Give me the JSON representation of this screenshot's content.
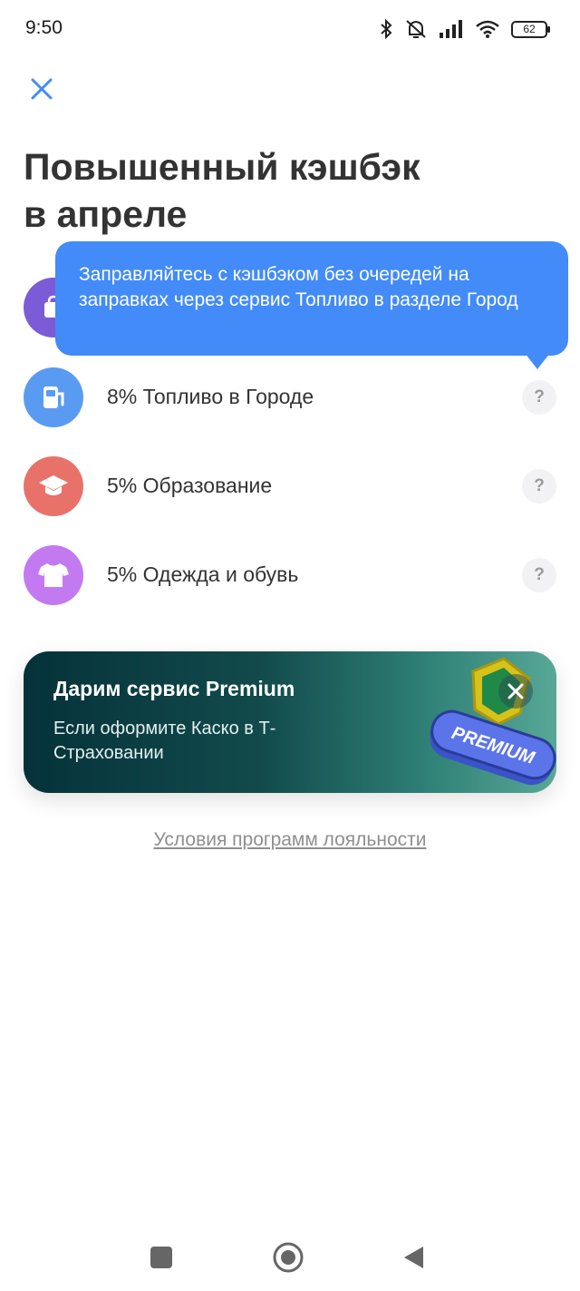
{
  "status_bar": {
    "time": "9:50",
    "battery": "62",
    "icons": [
      "bluetooth-icon",
      "mute-icon",
      "signal-icon",
      "wifi-icon",
      "battery-icon"
    ]
  },
  "header": {
    "close_icon": "close-icon",
    "title_line1": "Повышенный кэшбэк",
    "title_line2": "в апреле"
  },
  "tooltip": {
    "text": "Заправляйтесь с кэшбэком без очередей на заправках через сервис Топливо в разделе Город"
  },
  "cashback_items": [
    {
      "label": "",
      "icon": "shop-bag-icon",
      "color": "#7b5bd6"
    },
    {
      "label": "8% Топливо в Городе",
      "icon": "fuel-icon",
      "color": "#5a9bf2"
    },
    {
      "label": "5% Образование",
      "icon": "graduation-cap-icon",
      "color": "#e8726a"
    },
    {
      "label": "5% Одежда и обувь",
      "icon": "tshirt-icon",
      "color": "#c37af0"
    }
  ],
  "help_label": "?",
  "promo": {
    "title": "Дарим сервис Premium",
    "text": "Если оформите Каско в Т-Страховании",
    "badge_text": "PREMIUM"
  },
  "loyalty_link": "Условия программ лояльности",
  "colors": {
    "accent": "#428bf9",
    "title": "#333333"
  }
}
